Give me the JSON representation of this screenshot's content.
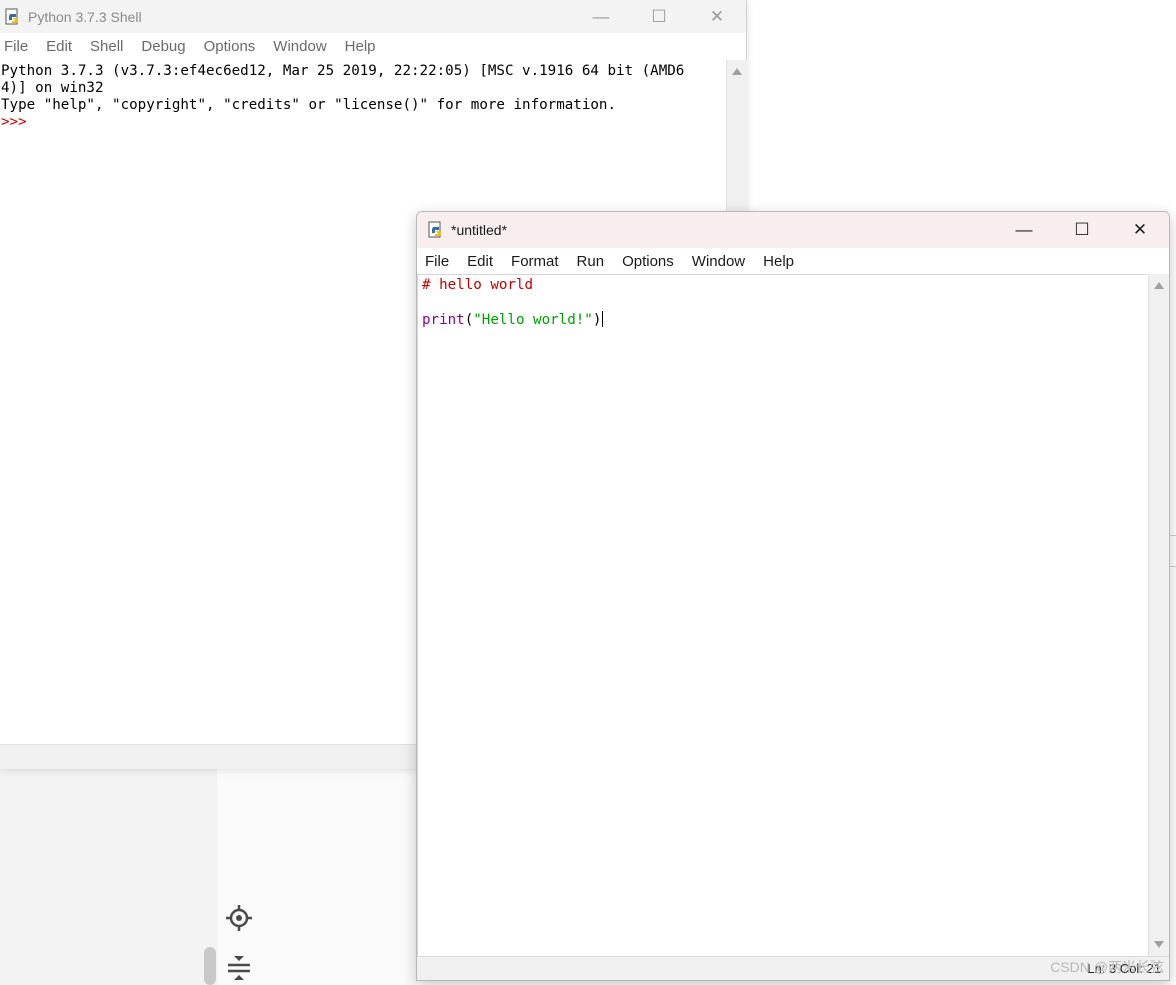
{
  "shell": {
    "title": "Python 3.7.3 Shell",
    "menu": [
      "File",
      "Edit",
      "Shell",
      "Debug",
      "Options",
      "Window",
      "Help"
    ],
    "lines": {
      "l1": "Python 3.7.3 (v3.7.3:ef4ec6ed12, Mar 25 2019, 22:22:05) [MSC v.1916 64 bit (AMD6",
      "l2": "4)] on win32",
      "l3": "Type \"help\", \"copyright\", \"credits\" or \"license()\" for more information.",
      "prompt": ">>>"
    }
  },
  "editor": {
    "title": "*untitled*",
    "menu": [
      "File",
      "Edit",
      "Format",
      "Run",
      "Options",
      "Window",
      "Help"
    ],
    "code": {
      "comment": "# hello world",
      "func": "print",
      "open_paren": "(",
      "string": "\"Hello world!\"",
      "close_paren": ")"
    },
    "status": "Ln: 3  Col: 21"
  },
  "window_controls": {
    "minimize": "—",
    "maximize": "☐",
    "close": "✕"
  },
  "watermark": "CSDN @两米长弦",
  "background_icons": [
    "crosshair-icon",
    "collapse-icon"
  ],
  "colors": {
    "comment": "#c00000",
    "builtin": "#900090",
    "string": "#00a000",
    "prompt": "#c00000"
  }
}
